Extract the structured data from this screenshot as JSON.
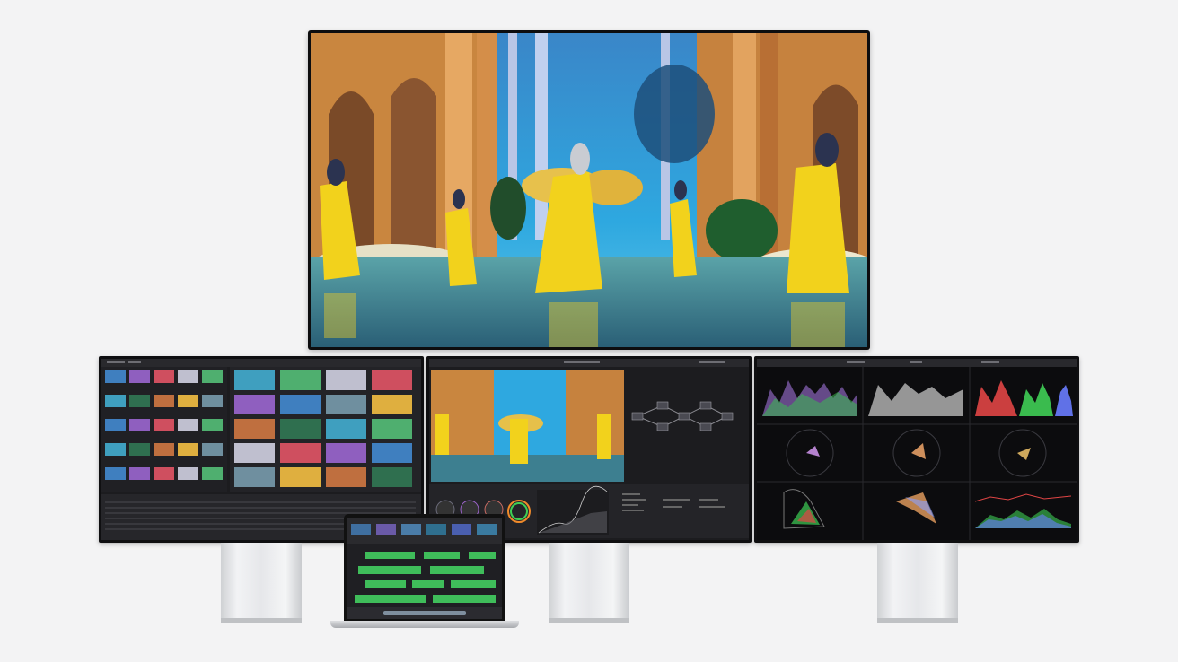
{
  "scene": {
    "background": "#f3f3f4",
    "devices": [
      {
        "id": "tv",
        "type": "television",
        "content": "stage-performance-image"
      },
      {
        "id": "monitor-left",
        "type": "display",
        "content": "media-browser"
      },
      {
        "id": "monitor-center",
        "type": "display",
        "content": "color-grading-viewer"
      },
      {
        "id": "monitor-right",
        "type": "display",
        "content": "video-scopes"
      },
      {
        "id": "laptop",
        "type": "laptop",
        "content": "audio-editor"
      }
    ]
  },
  "colors": {
    "tv_sky": "#2f8fd6",
    "tv_costume": "#f2d21c",
    "tv_floor": "#2c6f86",
    "scope_red": "#e04545",
    "scope_green": "#3fcf55",
    "scope_blue": "#6a7dff",
    "wave_green": "#3fbd5a",
    "accent_orange": "#f08a2a"
  }
}
